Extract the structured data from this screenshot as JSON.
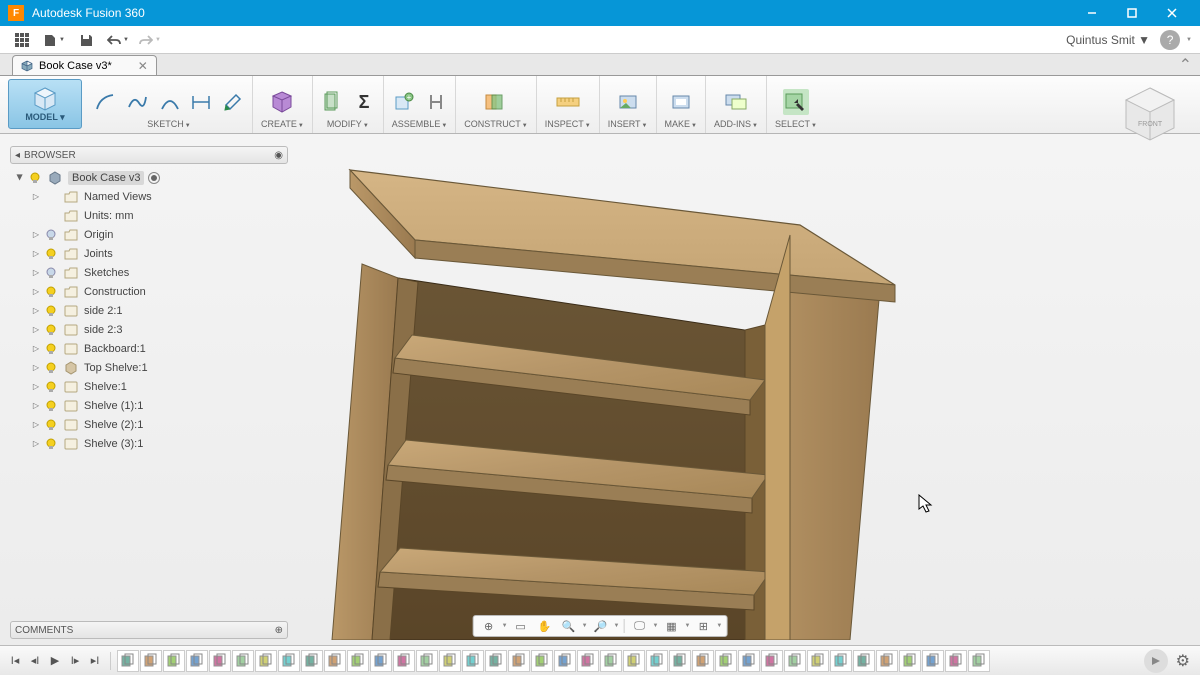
{
  "titlebar": {
    "app_name": "Autodesk Fusion 360"
  },
  "quickbar": {
    "user": "Quintus Smit"
  },
  "doctab": {
    "name": "Book Case v3*"
  },
  "ribbon": {
    "model": "MODEL",
    "sketch": "SKETCH",
    "create": "CREATE",
    "modify": "MODIFY",
    "assemble": "ASSEMBLE",
    "construct": "CONSTRUCT",
    "inspect": "INSPECT",
    "insert": "INSERT",
    "make": "MAKE",
    "addins": "ADD-INS",
    "select": "SELECT"
  },
  "browser": {
    "title": "BROWSER",
    "root": "Book Case v3",
    "items": [
      {
        "label": "Named Views",
        "bulb": "none",
        "icon": "folder"
      },
      {
        "label": "Units: mm",
        "bulb": "none",
        "icon": "folder",
        "noarrow": true
      },
      {
        "label": "Origin",
        "bulb": "off",
        "icon": "folder"
      },
      {
        "label": "Joints",
        "bulb": "on",
        "icon": "folder"
      },
      {
        "label": "Sketches",
        "bulb": "off",
        "icon": "folder"
      },
      {
        "label": "Construction",
        "bulb": "on",
        "icon": "folder"
      },
      {
        "label": "side 2:1",
        "bulb": "on",
        "icon": "comp"
      },
      {
        "label": "side 2:3",
        "bulb": "on",
        "icon": "comp"
      },
      {
        "label": "Backboard:1",
        "bulb": "on",
        "icon": "comp"
      },
      {
        "label": "Top Shelve:1",
        "bulb": "on",
        "icon": "body"
      },
      {
        "label": "Shelve:1",
        "bulb": "on",
        "icon": "comp"
      },
      {
        "label": "Shelve (1):1",
        "bulb": "on",
        "icon": "comp"
      },
      {
        "label": "Shelve (2):1",
        "bulb": "on",
        "icon": "comp"
      },
      {
        "label": "Shelve (3):1",
        "bulb": "on",
        "icon": "comp"
      }
    ]
  },
  "comments": {
    "title": "COMMENTS"
  },
  "viewcube": {
    "face": "FRONT"
  },
  "timeline_count": 38
}
